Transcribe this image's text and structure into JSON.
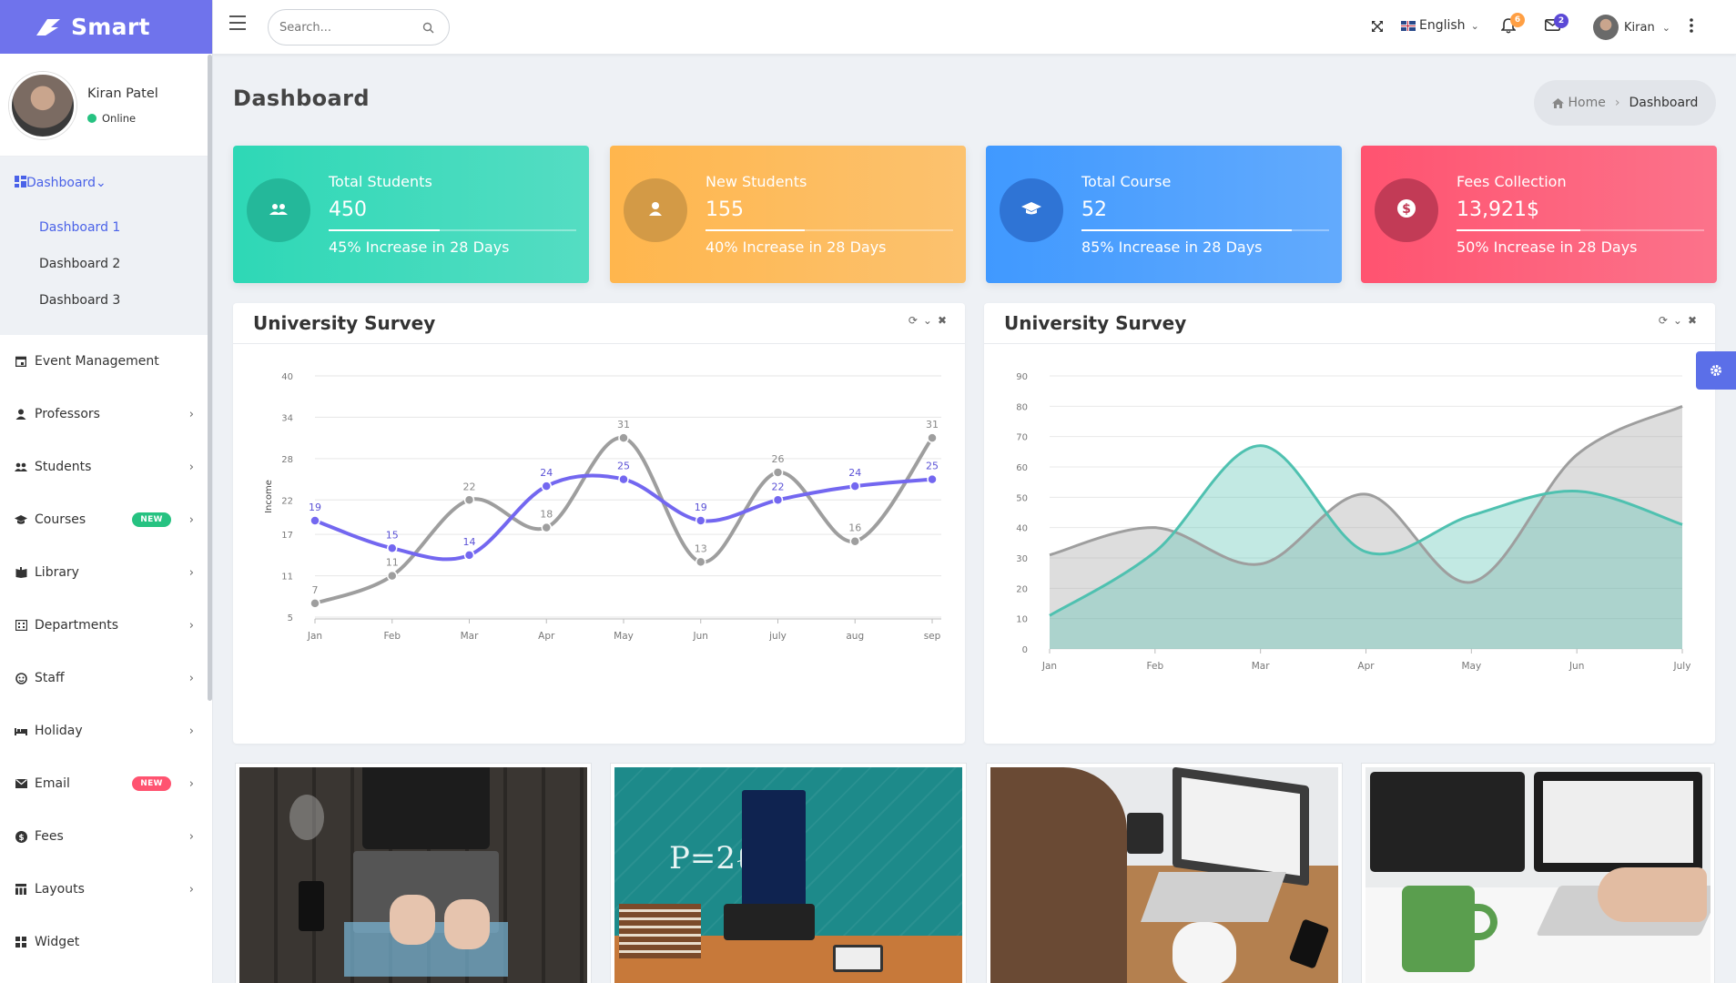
{
  "brand": {
    "name": "Smart"
  },
  "user": {
    "name": "Kiran Patel",
    "status": "Online"
  },
  "sidebar": {
    "dashboard": {
      "label": "Dashboard",
      "sub": [
        "Dashboard 1",
        "Dashboard 2",
        "Dashboard 3"
      ]
    },
    "items": [
      {
        "label": "Event Management",
        "icon": "calendar-icon"
      },
      {
        "label": "Professors",
        "icon": "user-icon"
      },
      {
        "label": "Students",
        "icon": "group-icon"
      },
      {
        "label": "Courses",
        "icon": "graduation-icon",
        "badge": "NEW"
      },
      {
        "label": "Library",
        "icon": "book-icon"
      },
      {
        "label": "Departments",
        "icon": "building-icon"
      },
      {
        "label": "Staff",
        "icon": "staff-icon"
      },
      {
        "label": "Holiday",
        "icon": "bed-icon"
      },
      {
        "label": "Email",
        "icon": "mail-icon",
        "badge": "NEW"
      },
      {
        "label": "Fees",
        "icon": "dollar-icon"
      },
      {
        "label": "Layouts",
        "icon": "layouts-icon"
      },
      {
        "label": "Widget",
        "icon": "widget-icon"
      }
    ]
  },
  "topbar": {
    "search_placeholder": "Search...",
    "language": "English",
    "notifications": "6",
    "messages": "2",
    "user": "Kiran"
  },
  "page": {
    "title": "Dashboard",
    "breadcrumb": {
      "home": "Home",
      "current": "Dashboard"
    }
  },
  "stats": [
    {
      "title": "Total Students",
      "value": "450",
      "desc": "45% Increase in 28 Days",
      "progress": 0.45,
      "color": "#2ed8b6",
      "icon": "users-icon"
    },
    {
      "title": "New Students",
      "value": "155",
      "desc": "40% Increase in 28 Days",
      "progress": 0.4,
      "color": "#ffb64d",
      "icon": "user-icon"
    },
    {
      "title": "Total Course",
      "value": "52",
      "desc": "85% Increase in 28 Days",
      "progress": 0.85,
      "color": "#4099ff",
      "icon": "graduation-icon"
    },
    {
      "title": "Fees Collection",
      "value": "13,921$",
      "desc": "50% Increase in 28 Days",
      "progress": 0.5,
      "color": "#ff5370",
      "icon": "dollar-icon"
    }
  ],
  "charts": {
    "left_title": "University Survey",
    "right_title": "University Survey"
  },
  "chart_data": [
    {
      "type": "line",
      "title": "University Survey",
      "ylabel": "Income",
      "categories": [
        "Jan",
        "Feb",
        "Mar",
        "Apr",
        "May",
        "Jun",
        "july",
        "aug",
        "sep"
      ],
      "yticks": [
        5,
        11,
        17,
        22,
        28,
        34,
        40
      ],
      "ylim": [
        5,
        40
      ],
      "series": [
        {
          "values": [
            19,
            15,
            14,
            24,
            25,
            19,
            22,
            24,
            25
          ],
          "color": "#7367f0"
        },
        {
          "values": [
            7,
            11,
            22,
            18,
            31,
            13,
            26,
            16,
            31
          ],
          "color": "#9e9e9e"
        }
      ]
    },
    {
      "type": "area",
      "title": "University Survey",
      "categories": [
        "Jan",
        "Feb",
        "Mar",
        "Apr",
        "May",
        "Jun",
        "July"
      ],
      "yticks": [
        0,
        10,
        20,
        30,
        40,
        50,
        60,
        70,
        80,
        90
      ],
      "ylim": [
        0,
        90
      ],
      "series": [
        {
          "values": [
            31,
            40,
            28,
            51,
            22,
            64,
            80
          ],
          "color": "#9e9e9e"
        },
        {
          "values": [
            11,
            32,
            67,
            32,
            44,
            52,
            41
          ],
          "color": "#4fc1b0"
        }
      ]
    }
  ]
}
